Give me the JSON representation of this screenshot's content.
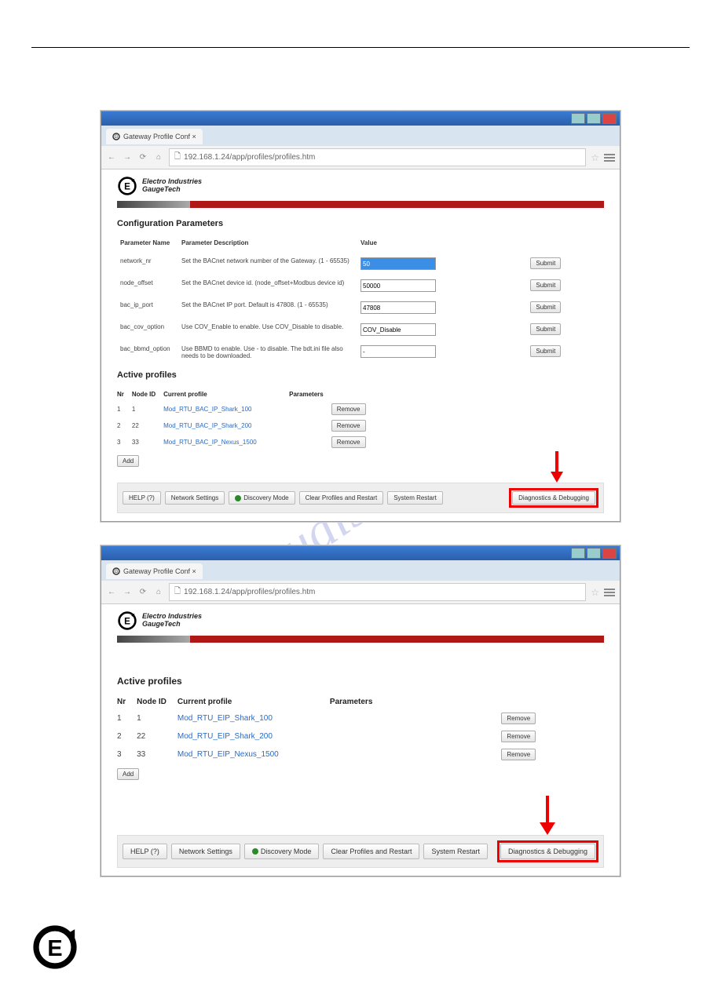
{
  "watermark": "manualslive.com",
  "browser": {
    "tab_title": "Gateway Profile Conf",
    "url": "192.168.1.24/app/profiles/profiles.htm"
  },
  "logo": {
    "line1": "Electro Industries",
    "line2": "GaugeTech"
  },
  "config": {
    "heading": "Configuration Parameters",
    "cols": {
      "name": "Parameter Name",
      "desc": "Parameter Description",
      "value": "Value"
    },
    "submit": "Submit",
    "rows": [
      {
        "name": "network_nr",
        "desc": "Set the BACnet network number of the Gateway. (1 - 65535)",
        "value": "50",
        "selected": true
      },
      {
        "name": "node_offset",
        "desc": "Set the BACnet device id. (node_offset+Modbus device id)",
        "value": "50000"
      },
      {
        "name": "bac_ip_port",
        "desc": "Set the BACnet IP port. Default is 47808. (1 - 65535)",
        "value": "47808"
      },
      {
        "name": "bac_cov_option",
        "desc": "Use COV_Enable to enable. Use COV_Disable to disable.",
        "value": "COV_Disable"
      },
      {
        "name": "bac_bbmd_option",
        "desc": "Use BBMD to enable. Use - to disable. The bdt.ini file also needs to be downloaded.",
        "value": "-"
      }
    ]
  },
  "profiles1": {
    "heading": "Active profiles",
    "cols": {
      "nr": "Nr",
      "node": "Node ID",
      "profile": "Current profile",
      "params": "Parameters"
    },
    "remove": "Remove",
    "add": "Add",
    "rows": [
      {
        "nr": "1",
        "node": "1",
        "profile": "Mod_RTU_BAC_IP_Shark_100"
      },
      {
        "nr": "2",
        "node": "22",
        "profile": "Mod_RTU_BAC_IP_Shark_200"
      },
      {
        "nr": "3",
        "node": "33",
        "profile": "Mod_RTU_BAC_IP_Nexus_1500"
      }
    ]
  },
  "profiles2": {
    "heading": "Active profiles",
    "cols": {
      "nr": "Nr",
      "node": "Node ID",
      "profile": "Current profile",
      "params": "Parameters"
    },
    "remove": "Remove",
    "add": "Add",
    "rows": [
      {
        "nr": "1",
        "node": "1",
        "profile": "Mod_RTU_EIP_Shark_100"
      },
      {
        "nr": "2",
        "node": "22",
        "profile": "Mod_RTU_EIP_Shark_200"
      },
      {
        "nr": "3",
        "node": "33",
        "profile": "Mod_RTU_EIP_Nexus_1500"
      }
    ]
  },
  "footer": {
    "help": "HELP (?)",
    "network": "Network Settings",
    "discovery": "Discovery Mode",
    "clear": "Clear Profiles and Restart",
    "restart": "System Restart",
    "diag": "Diagnostics & Debugging"
  }
}
